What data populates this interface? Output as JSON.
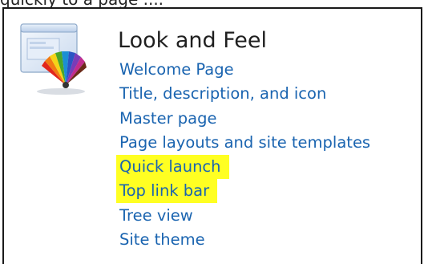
{
  "top_fragment": "quickly to a page ....",
  "look_and_feel": {
    "title": "Look and Feel",
    "icon": "palette-window-icon",
    "links": [
      {
        "label": "Welcome Page",
        "highlighted": false
      },
      {
        "label": "Title, description, and icon",
        "highlighted": false
      },
      {
        "label": "Master page",
        "highlighted": false
      },
      {
        "label": "Page layouts and site templates",
        "highlighted": false
      },
      {
        "label": "Quick launch",
        "highlighted": true
      },
      {
        "label": "Top link bar",
        "highlighted": true
      },
      {
        "label": "Tree view",
        "highlighted": false
      },
      {
        "label": "Site theme",
        "highlighted": false
      }
    ]
  },
  "colors": {
    "link": "#1a64b0",
    "highlight": "#ffff22",
    "title": "#1f1f1f"
  }
}
